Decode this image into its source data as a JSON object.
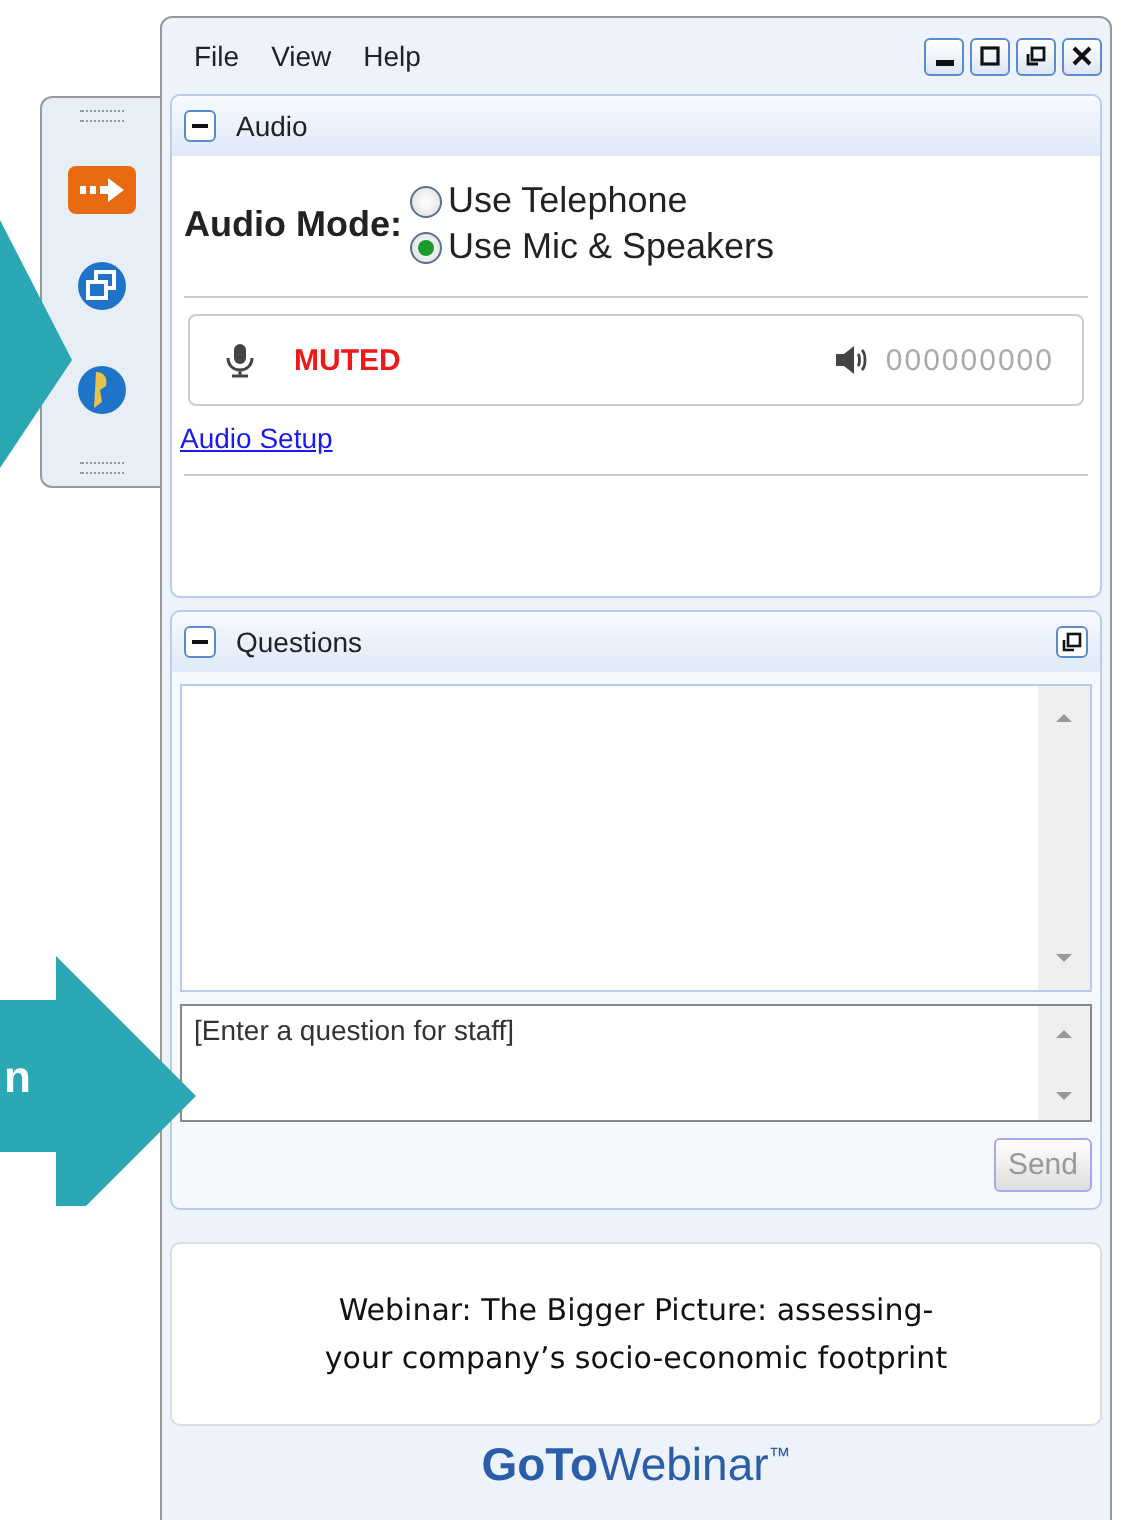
{
  "menu": [
    {
      "label": "File"
    },
    {
      "label": "View"
    },
    {
      "label": "Help"
    }
  ],
  "audio": {
    "title": "Audio",
    "expanded": true,
    "mode_label": "Audio Mode:",
    "options": [
      {
        "label": "Use Telephone",
        "selected": false
      },
      {
        "label": "Use Mic & Speakers",
        "selected": true
      }
    ],
    "mic_status": "MUTED",
    "pin": "000000000",
    "setup_link": "Audio Setup"
  },
  "questions": {
    "title": "Questions",
    "expanded": true,
    "placeholder": "[Enter a question for staff]",
    "send": "Send",
    "send_disabled": true
  },
  "webinar_title": "Webinar: The Bigger Picture: assessing-\nyour company’s socio-economic footprint",
  "brand": {
    "bold": "GoTo",
    "rest": "Webinar",
    "mark": "™"
  },
  "callout_text": "n"
}
